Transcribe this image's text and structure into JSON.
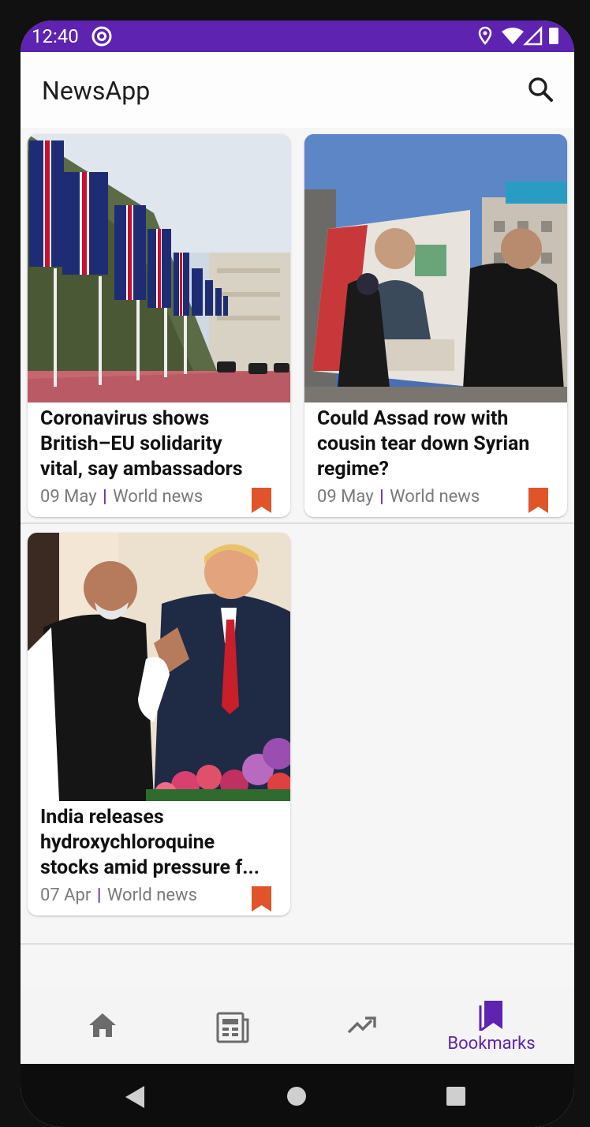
{
  "status_bar": {
    "time": "12:40",
    "background_color": "#5e23b0",
    "icons": [
      "at-sign-icon",
      "location-icon",
      "wifi-icon",
      "signal-icon",
      "battery-icon"
    ]
  },
  "app_bar": {
    "title": "NewsApp",
    "search_icon": "search-icon"
  },
  "articles": [
    {
      "title": "Coronavirus shows\nBritish–EU solidarity\nvital, say ambassadors",
      "date": "09 May",
      "separator": "|",
      "section": "World news",
      "bookmarked": true,
      "image": "union-jack-flags-on-the-mall"
    },
    {
      "title": "Could Assad row with\ncousin tear down Syrian\nregime?",
      "date": "09 May",
      "separator": "|",
      "section": "World news",
      "bookmarked": true,
      "image": "assad-poster-street-scene"
    },
    {
      "title": "India releases\nhydroxychloroquine\nstocks amid pressure f...",
      "date": "07 Apr",
      "separator": "|",
      "section": "World news",
      "bookmarked": true,
      "image": "modi-and-trump"
    }
  ],
  "bottom_nav": {
    "items": [
      {
        "icon": "home-icon",
        "label": ""
      },
      {
        "icon": "newspaper-icon",
        "label": ""
      },
      {
        "icon": "trending-icon",
        "label": ""
      },
      {
        "icon": "bookmarks-icon",
        "label": "Bookmarks",
        "active": true
      }
    ],
    "active_color": "#5e23b0",
    "inactive_color": "#6b6b6b"
  },
  "colors": {
    "accent": "#5e23b0",
    "bookmark": "#e0542a"
  }
}
